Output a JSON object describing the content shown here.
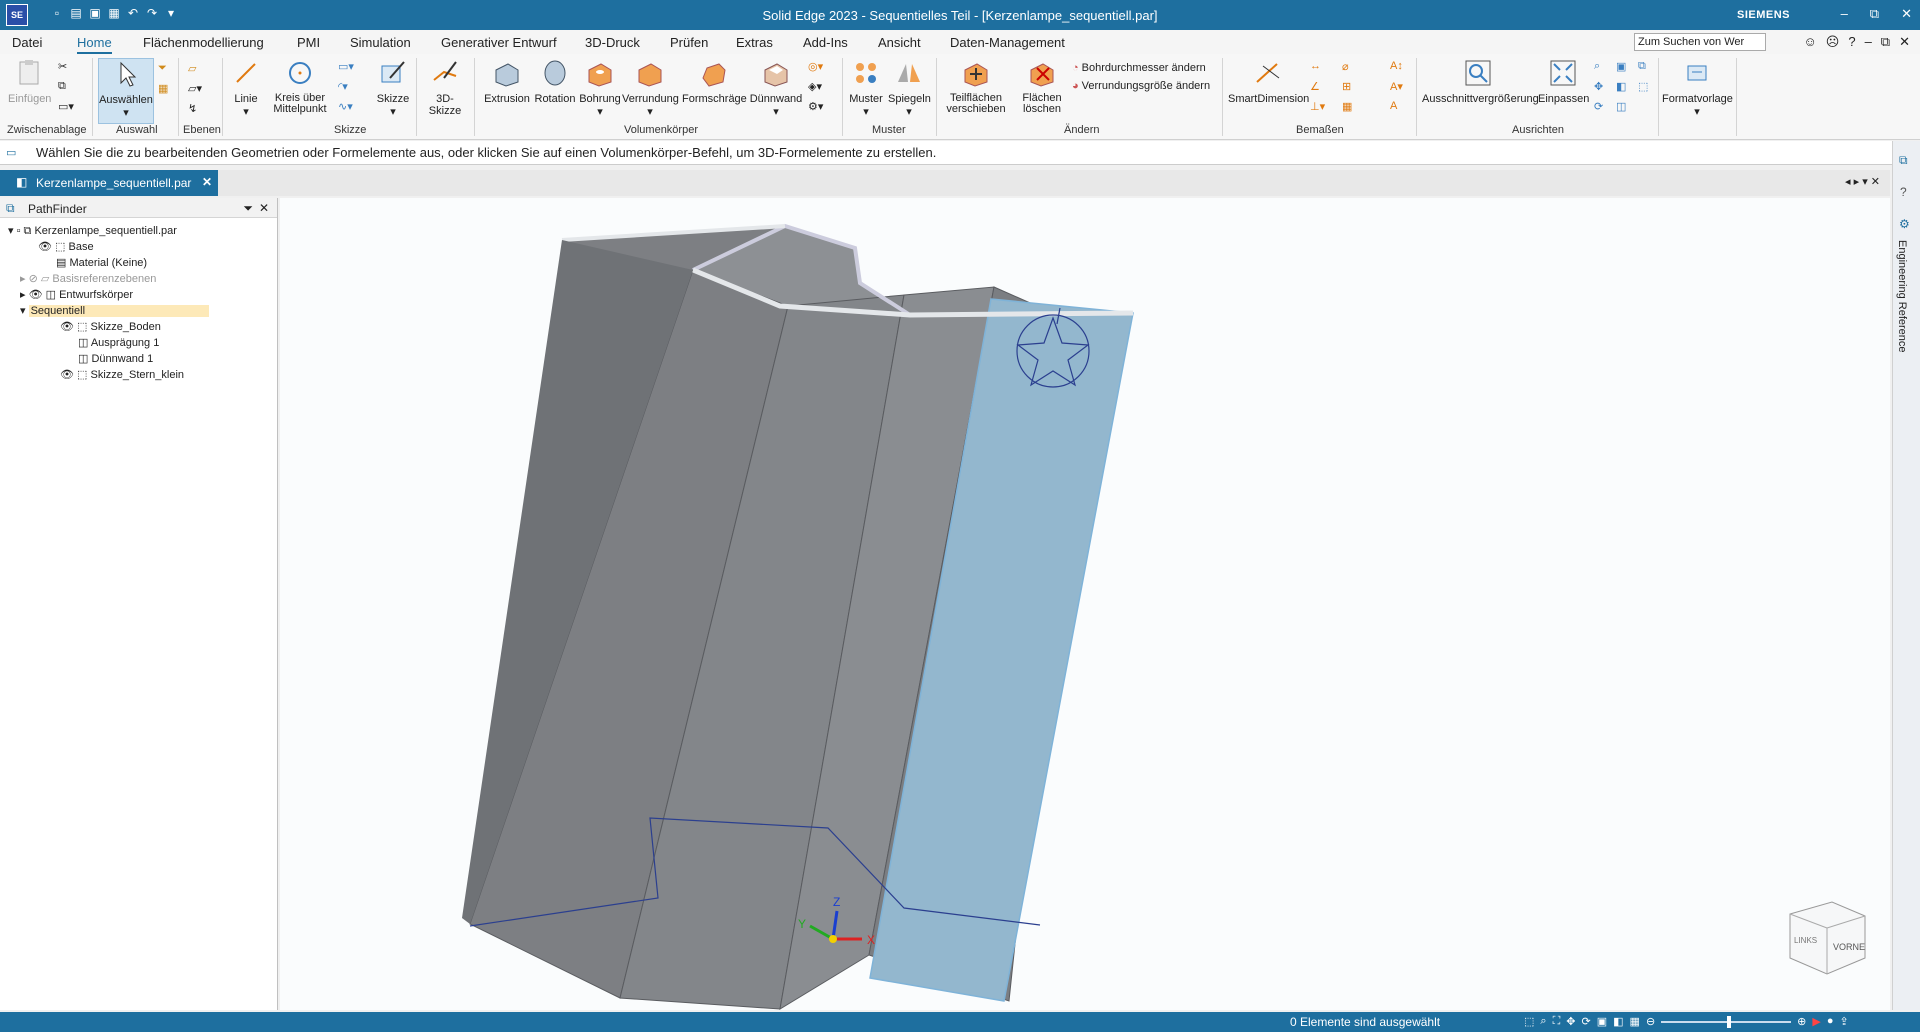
{
  "titlebar": {
    "logo": "SE",
    "title": "Solid Edge 2023 - Sequentielles Teil - [Kerzenlampe_sequentiell.par]",
    "brand": "SIEMENS",
    "controls": [
      "–",
      "⧉",
      "✕"
    ]
  },
  "menubar": {
    "tabs": [
      "Datei",
      "Home",
      "Flächenmodellierung",
      "PMI",
      "Simulation",
      "Generativer Entwurf",
      "3D-Druck",
      "Prüfen",
      "Extras",
      "Add-Ins",
      "Ansicht",
      "Daten-Management"
    ],
    "active_tab": "Home",
    "search_placeholder": "Zum Suchen von Wer"
  },
  "ribbon": {
    "einfuegen": "Einfügen",
    "zwischenablage": "Zwischenablage",
    "auswaehlen": "Auswählen",
    "auswahl": "Auswahl",
    "ebenen": "Ebenen",
    "linie": "Linie",
    "kreis": "Kreis über Mittelpunkt",
    "skizze_btn": "Skizze",
    "skizze_group": "Skizze",
    "skizze3d": "3D-Skizze",
    "extrusion": "Extrusion",
    "rotation": "Rotation",
    "bohrung": "Bohrung",
    "verrundung": "Verrundung",
    "formschraege": "Formschräge",
    "duennwand": "Dünnwand",
    "volumenkoerper": "Volumenkörper",
    "muster_btn": "Muster",
    "spiegeln": "Spiegeln",
    "muster_group": "Muster",
    "teilflaechen": "Teilflächen verschieben",
    "flaechen_loeschen": "Flächen löschen",
    "bohrdurchmesser": "Bohrdurchmesser ändern",
    "verrundungsgroesse": "Verrundungsgröße ändern",
    "aendern": "Ändern",
    "smartdimension": "SmartDimension",
    "bemassen": "Bemaßen",
    "ausschnitt": "Ausschnittvergrößerung",
    "einpassen": "Einpassen",
    "ausrichten": "Ausrichten",
    "formatvorlage": "Formatvorlage"
  },
  "prompt": "Wählen Sie die zu bearbeitenden Geometrien oder Formelemente aus, oder klicken Sie auf einen Volumenkörper-Befehl, um 3D-Formelemente zu erstellen.",
  "document_tab": "Kerzenlampe_sequentiell.par",
  "pathfinder": {
    "title": "PathFinder",
    "root": "Kerzenlampe_sequentiell.par",
    "base": "Base",
    "material": "Material (Keine)",
    "basisreferenzebenen": "Basisreferenzebenen",
    "entwurfskoerper": "Entwurfskörper",
    "sequentiell": "Sequentiell",
    "skizze_boden": "Skizze_Boden",
    "auspraegung": "Ausprägung 1",
    "duennwand": "Dünnwand 1",
    "skizze_stern": "Skizze_Stern_klein"
  },
  "viewcube": {
    "left": "LINKS",
    "front": "VORNE"
  },
  "axes": {
    "x": "X",
    "y": "Y",
    "z": "Z"
  },
  "right_panel": "Engineering Reference",
  "status": "0 Elemente sind ausgewählt",
  "colors": {
    "brand_blue": "#1e6f9f",
    "face_blue": "#93b7ce",
    "body_gray": "#7f8185",
    "selection": "#fde9b8"
  }
}
